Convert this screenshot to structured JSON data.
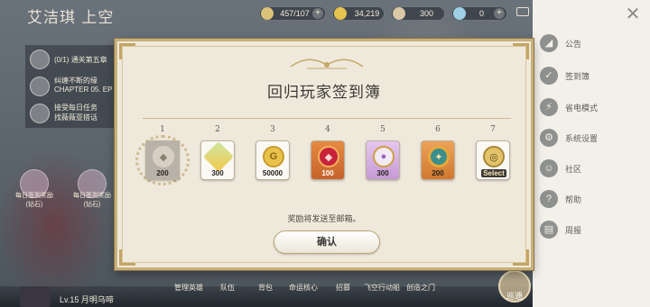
{
  "player": {
    "name": "艾洁琪 上空",
    "level_line": "Lv.15 月明乌啼"
  },
  "resources": [
    {
      "icon": "stamina-icon",
      "value": "457/107",
      "color": "#d9c37a"
    },
    {
      "icon": "gold-coin-icon",
      "value": "34,219",
      "color": "#e6c24f"
    },
    {
      "icon": "diamond-icon",
      "value": "300",
      "color": "#d8c8a8"
    },
    {
      "icon": "crystal-icon",
      "value": "0",
      "color": "#9fd0e6"
    }
  ],
  "quests": [
    {
      "tag": "(0/1)",
      "text": "通关第五章"
    },
    {
      "text": "纠缠不断的缘",
      "sub": "CHAPTER 05. EP"
    },
    {
      "text": "接受每日任务",
      "sub": "找薇薇亚搭话"
    }
  ],
  "side_icons": [
    {
      "label": "每日签到奖励 (钻石)"
    },
    {
      "label": "每日签到奖励 (钻石)"
    }
  ],
  "bottom_nav": [
    "管理英雄",
    "队伍",
    "背包",
    "命运核心",
    "招募",
    "飞空行动船",
    "创造之门"
  ],
  "bottom_confirm": "巡遗",
  "right_menu": [
    {
      "icon": "announcement-icon",
      "label": "公告"
    },
    {
      "icon": "checkin-icon",
      "label": "签到簿"
    },
    {
      "icon": "power-save-icon",
      "label": "省电模式"
    },
    {
      "icon": "settings-gear-icon",
      "label": "系统设置"
    },
    {
      "icon": "community-icon",
      "label": "社区"
    },
    {
      "icon": "help-icon",
      "label": "帮助"
    },
    {
      "icon": "terms-icon",
      "label": "周报"
    }
  ],
  "modal": {
    "title": "回归玩家签到簿",
    "notice": "奖励将发送至邮箱。",
    "confirm_label": "确认",
    "days": [
      {
        "day": "1",
        "reward": "diamond-icon",
        "qty": "200",
        "claimed": true
      },
      {
        "day": "2",
        "reward": "crystal-shard-icon",
        "qty": "300"
      },
      {
        "day": "3",
        "reward": "gold-coin-icon",
        "qty": "50000"
      },
      {
        "day": "4",
        "reward": "red-gem-icon",
        "qty": "100"
      },
      {
        "day": "5",
        "reward": "purple-orb-icon",
        "qty": "300"
      },
      {
        "day": "6",
        "reward": "amber-relic-icon",
        "qty": "200"
      },
      {
        "day": "7",
        "reward": "select-ticket-icon",
        "qty": "Select"
      }
    ]
  },
  "colors": {
    "panel": "#efe9dc",
    "border_gold": "#c9b07a",
    "right_panel": "#f3f0ea"
  }
}
